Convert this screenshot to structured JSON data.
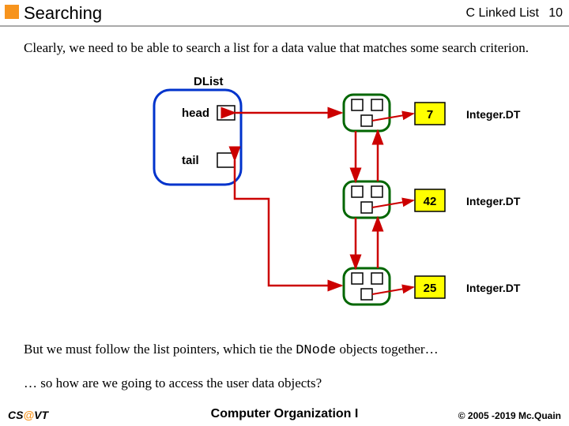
{
  "header": {
    "title": "Searching",
    "topic": "C Linked List",
    "page": "10"
  },
  "text": {
    "intro": "Clearly, we need to be able to search a list for a data value that matches some search criterion.",
    "mid1_a": "But we must follow the list pointers, which tie the ",
    "mid1_code": "DNode",
    "mid1_b": " objects together…",
    "mid2": "… so how are we going to access the user data objects?"
  },
  "diagram": {
    "dlist_label": "DList",
    "head_label": "head",
    "tail_label": "tail",
    "nodes": [
      {
        "value": "7",
        "type_label": "Integer.DT"
      },
      {
        "value": "42",
        "type_label": "Integer.DT"
      },
      {
        "value": "25",
        "type_label": "Integer.DT"
      }
    ]
  },
  "footer": {
    "left_a": "CS",
    "left_at": "@",
    "left_b": "VT",
    "mid": "Computer Organization I",
    "right": "© 2005 -2019 Mc.Quain"
  }
}
